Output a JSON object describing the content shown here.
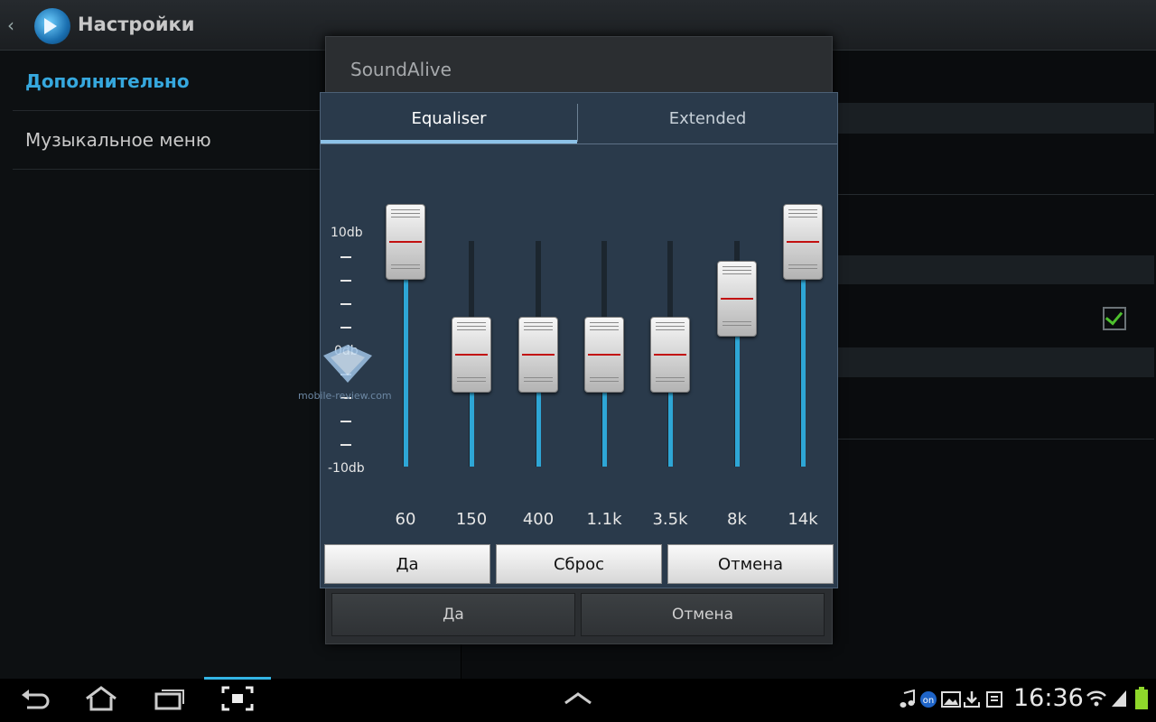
{
  "actionbar": {
    "back": "‹",
    "title": "Настройки"
  },
  "left_panel": {
    "items": [
      "Дополнительно",
      "Музыкальное меню"
    ]
  },
  "soundalive": {
    "title": "SoundAlive",
    "ok": "Да",
    "cancel": "Отмена"
  },
  "equalizer": {
    "tabs": [
      "Equaliser",
      "Extended"
    ],
    "active_tab": "Equaliser",
    "scale": {
      "max": "10db",
      "mid": "0db",
      "min": "-10db"
    },
    "bands": [
      {
        "label": "60",
        "level_db": 10
      },
      {
        "label": "150",
        "level_db": 0
      },
      {
        "label": "400",
        "level_db": 0
      },
      {
        "label": "1.1k",
        "level_db": 0
      },
      {
        "label": "3.5k",
        "level_db": 0
      },
      {
        "label": "8k",
        "level_db": 5
      },
      {
        "label": "14k",
        "level_db": 10
      }
    ],
    "buttons": {
      "ok": "Да",
      "reset": "Сброс",
      "cancel": "Отмена"
    }
  },
  "watermark": "mobile-review.com",
  "status": {
    "time": "16:36"
  },
  "colors": {
    "accent": "#33b5e5",
    "slider_fill": "#2ea6d6",
    "check_green": "#4ec12e"
  }
}
